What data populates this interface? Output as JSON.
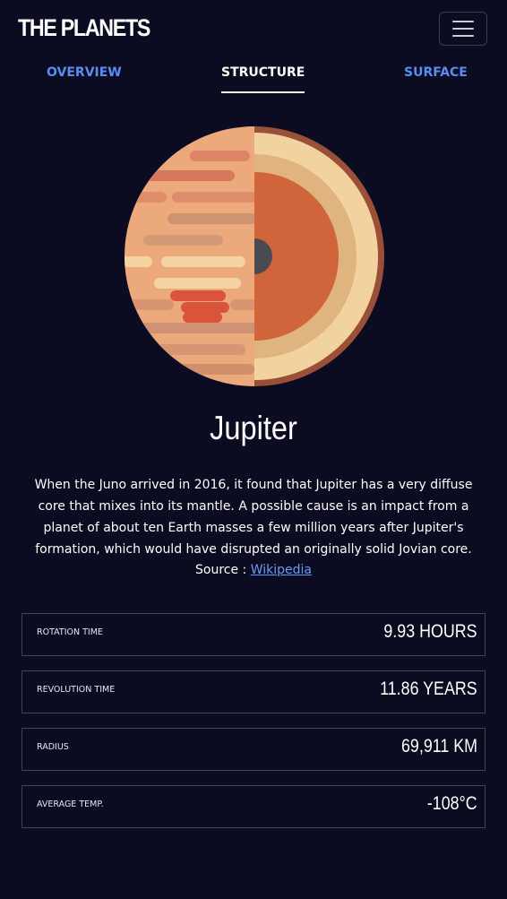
{
  "header": {
    "brand": "THE PLANETS",
    "menu_icon": "hamburger-icon"
  },
  "tabs": [
    {
      "label": "OVERVIEW",
      "active": false
    },
    {
      "label": "STRUCTURE",
      "active": true
    },
    {
      "label": "SURFACE",
      "active": false
    }
  ],
  "planet": {
    "image": "jupiter-internal-structure",
    "name": "Jupiter",
    "description": "When the Juno arrived in 2016, it found that Jupiter has a very diffuse core that mixes into its mantle. A possible cause is an impact from a planet of about ten Earth masses a few million years after Jupiter's formation, which would have disrupted an originally solid Jovian core.",
    "source_label": "Source :",
    "source_link": "Wikipedia"
  },
  "stats": [
    {
      "label": "ROTATION TIME",
      "value": "9.93 HOURS"
    },
    {
      "label": "REVOLUTION TIME",
      "value": "11.86 YEARS"
    },
    {
      "label": "RADIUS",
      "value": "69,911 KM"
    },
    {
      "label": "AVERAGE TEMP.",
      "value": "-108°C"
    }
  ],
  "colors": {
    "background": "#0b0b22",
    "tab_inactive": "#5b8cf2",
    "link": "#6b9bf5",
    "border": "#40425a"
  }
}
